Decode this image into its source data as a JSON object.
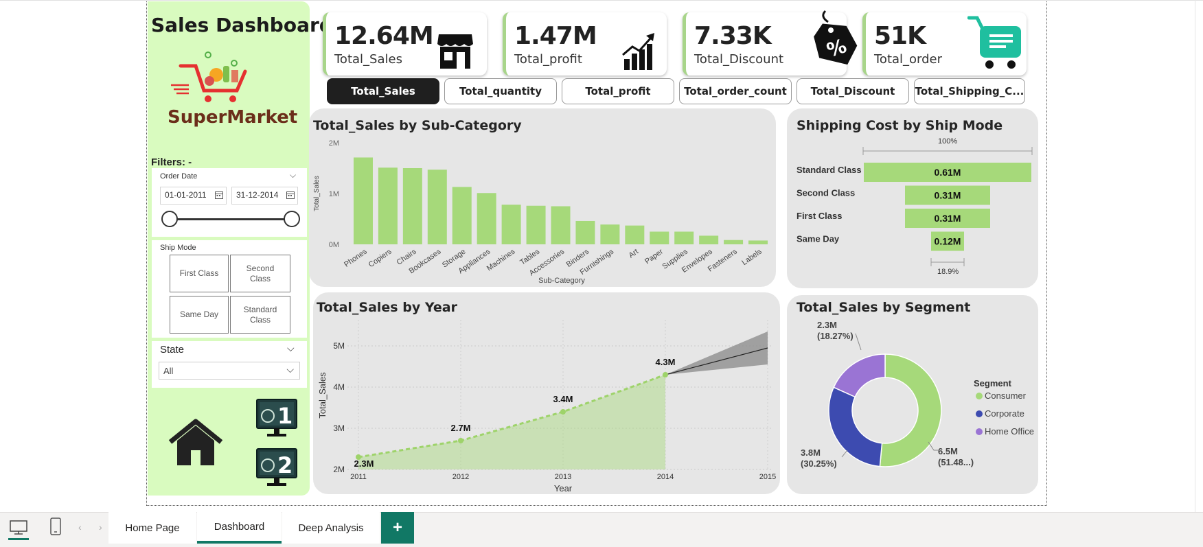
{
  "sidebar": {
    "title": "Sales Dashboard",
    "logo_text": "SuperMarket",
    "filters_label": "Filters: -",
    "order_date": {
      "label": "Order Date",
      "start": "01-01-2011",
      "end": "31-12-2014"
    },
    "ship_mode": {
      "label": "Ship Mode",
      "options": [
        "First Class",
        "Second Class",
        "Same Day",
        "Standard Class"
      ]
    },
    "state": {
      "label": "State",
      "value": "All"
    }
  },
  "kpis": [
    {
      "value": "12.64M",
      "label": "Total_Sales",
      "icon": "store-icon"
    },
    {
      "value": "1.47M",
      "label": "Total_profit",
      "icon": "growth-chart-icon"
    },
    {
      "value": "7.33K",
      "label": "Total_Discount",
      "icon": "discount-tag-icon"
    },
    {
      "value": "51K",
      "label": "Total_order",
      "icon": "shopping-cart-icon"
    }
  ],
  "measure_tabs": [
    "Total_Sales",
    "Total_quantity",
    "Total_profit",
    "Total_order_count",
    "Total_Discount",
    "Total_Shipping_C..."
  ],
  "active_measure_tab": "Total_Sales",
  "subcat_chart": {
    "title": "Total_Sales by Sub-Category"
  },
  "ship_chart": {
    "title": "Shipping Cost by Ship Mode",
    "top_label": "100%",
    "bottom_label": "18.9%"
  },
  "year_chart": {
    "title": "Total_Sales by Year"
  },
  "segment_chart": {
    "title": "Total_Sales by Segment",
    "legend_title": "Segment"
  },
  "bottom_tabs": [
    "Home Page",
    "Dashboard",
    "Deep Analysis"
  ],
  "active_bottom_tab": "Dashboard",
  "add_page_label": "+",
  "colors": {
    "bar": "#a6d97a",
    "sidebar": "#d9fbbf",
    "card": "#e6e6e6",
    "accent": "#117865",
    "corporate": "#3d4bb0",
    "home_office": "#9a74d4"
  },
  "chart_data": [
    {
      "type": "bar",
      "title": "Total_Sales by Sub-Category",
      "xlabel": "Sub-Category",
      "ylabel": "Total_Sales",
      "yticks": [
        "0M",
        "1M",
        "2M"
      ],
      "ylim": [
        0,
        2000000
      ],
      "categories": [
        "Phones",
        "Copiers",
        "Chairs",
        "Bookcases",
        "Storage",
        "Appliances",
        "Machines",
        "Tables",
        "Accessories",
        "Binders",
        "Furnishings",
        "Art",
        "Paper",
        "Supplies",
        "Envelopes",
        "Fasteners",
        "Labels"
      ],
      "values": [
        1710000,
        1510000,
        1500000,
        1470000,
        1130000,
        1010000,
        780000,
        760000,
        750000,
        460000,
        390000,
        370000,
        250000,
        250000,
        170000,
        85000,
        75000
      ]
    },
    {
      "type": "bar",
      "title": "Shipping Cost by Ship Mode",
      "categories": [
        "Standard Class",
        "Second Class",
        "First Class",
        "Same Day"
      ],
      "values": [
        0.61,
        0.31,
        0.31,
        0.12
      ],
      "labels": [
        "0.61M",
        "0.31M",
        "0.31M",
        "0.12M"
      ],
      "unit": "M"
    },
    {
      "type": "area",
      "title": "Total_Sales by Year",
      "xlabel": "Year",
      "ylabel": "Total_Sales",
      "x": [
        2011,
        2012,
        2013,
        2014
      ],
      "y": [
        2.3,
        2.7,
        3.4,
        4.3
      ],
      "labels": [
        "2.3M",
        "2.7M",
        "3.4M",
        "4.3M"
      ],
      "xticks": [
        "2011",
        "2012",
        "2013",
        "2014",
        "2015"
      ],
      "yticks": [
        "2M",
        "3M",
        "4M",
        "5M"
      ],
      "ylim": [
        2,
        5.5
      ],
      "forecast": {
        "x": [
          2014,
          2015
        ],
        "y": [
          4.3,
          4.95
        ],
        "upper": [
          4.3,
          5.35
        ],
        "lower": [
          4.3,
          4.55
        ]
      }
    },
    {
      "type": "pie",
      "title": "Total_Sales by Segment",
      "categories": [
        "Consumer",
        "Corporate",
        "Home Office"
      ],
      "values": [
        51.48,
        30.25,
        18.27
      ],
      "labels": [
        "6.5M\n(51.48...)",
        "3.8M\n(30.25%)",
        "2.3M\n(18.27%)"
      ],
      "legend": "right"
    }
  ]
}
